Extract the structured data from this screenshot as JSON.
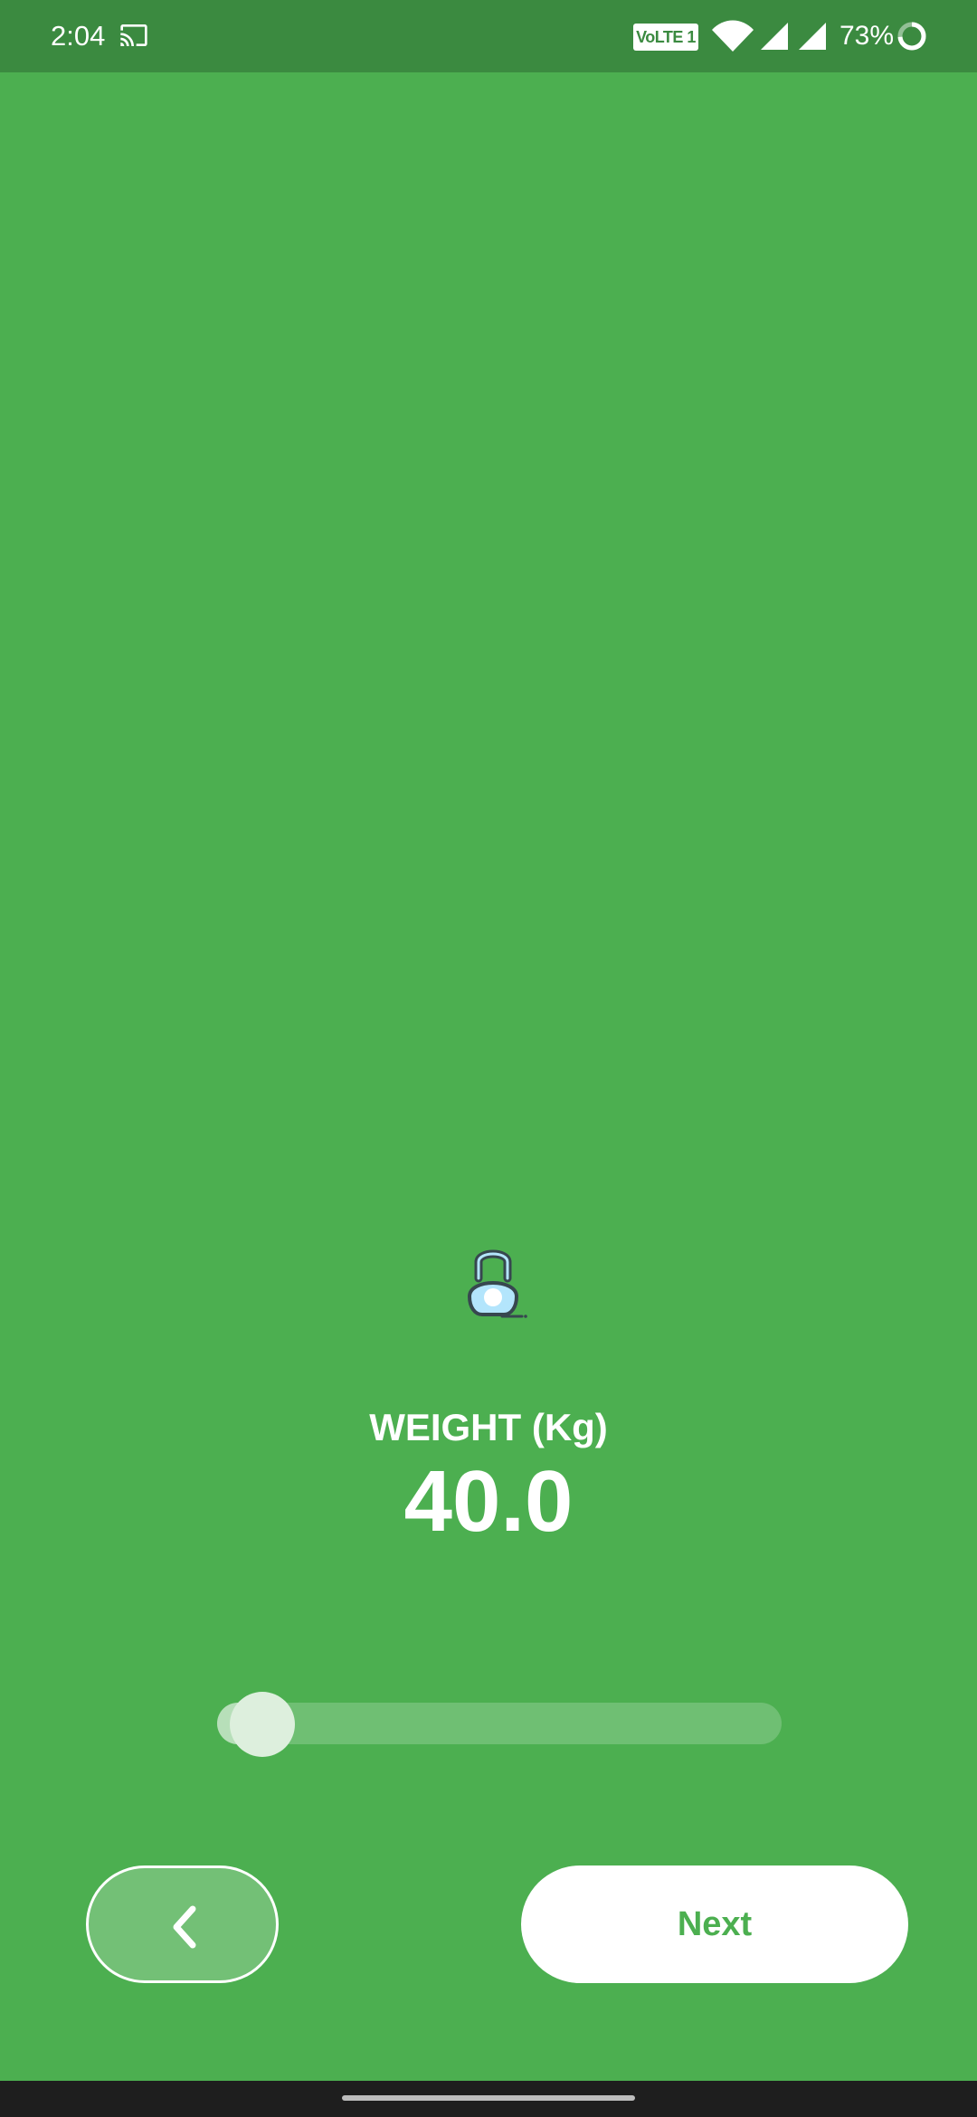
{
  "status_bar": {
    "time": "2:04",
    "volte": "VoLTE 1",
    "battery_percent": "73%",
    "icons": [
      "cast-icon",
      "volte-icon",
      "wifi-icon",
      "signal-icon",
      "signal-icon",
      "battery-icon"
    ]
  },
  "content": {
    "icon": "kettlebell-icon",
    "label": "WEIGHT (Kg)",
    "value": "40.0"
  },
  "slider": {
    "level": 0.08
  },
  "buttons": {
    "back_icon": "chevron-left-icon",
    "next_label": "Next"
  },
  "colors": {
    "background": "#4caf50",
    "status_bar": "#3b8a40",
    "button_text": "#4caf50",
    "nav_bar": "#1e1e1e"
  }
}
